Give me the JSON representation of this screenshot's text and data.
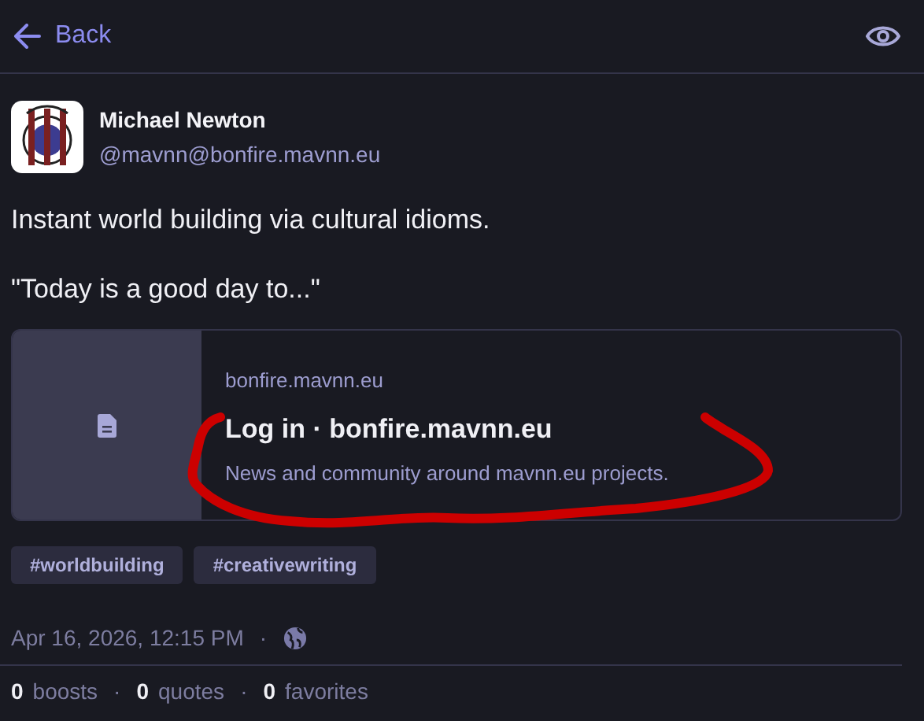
{
  "header": {
    "back_label": "Back"
  },
  "author": {
    "name": "Michael Newton",
    "handle": "@mavnn@bonfire.mavnn.eu"
  },
  "post": {
    "paragraphs": [
      "Instant world building via cultural idioms.",
      "\"Today is a good day to...\""
    ]
  },
  "link_card": {
    "domain": "bonfire.mavnn.eu",
    "title": "Log in · bonfire.mavnn.eu",
    "description": "News and community around mavnn.eu projects."
  },
  "tags": [
    "#worldbuilding",
    "#creativewriting"
  ],
  "meta": {
    "date": "Apr 16, 2026, 12:15 PM",
    "separator": "·"
  },
  "stats": [
    {
      "count": "0",
      "label": "boosts"
    },
    {
      "count": "0",
      "label": "quotes"
    },
    {
      "count": "0",
      "label": "favorites"
    }
  ],
  "stats_separator": "·"
}
